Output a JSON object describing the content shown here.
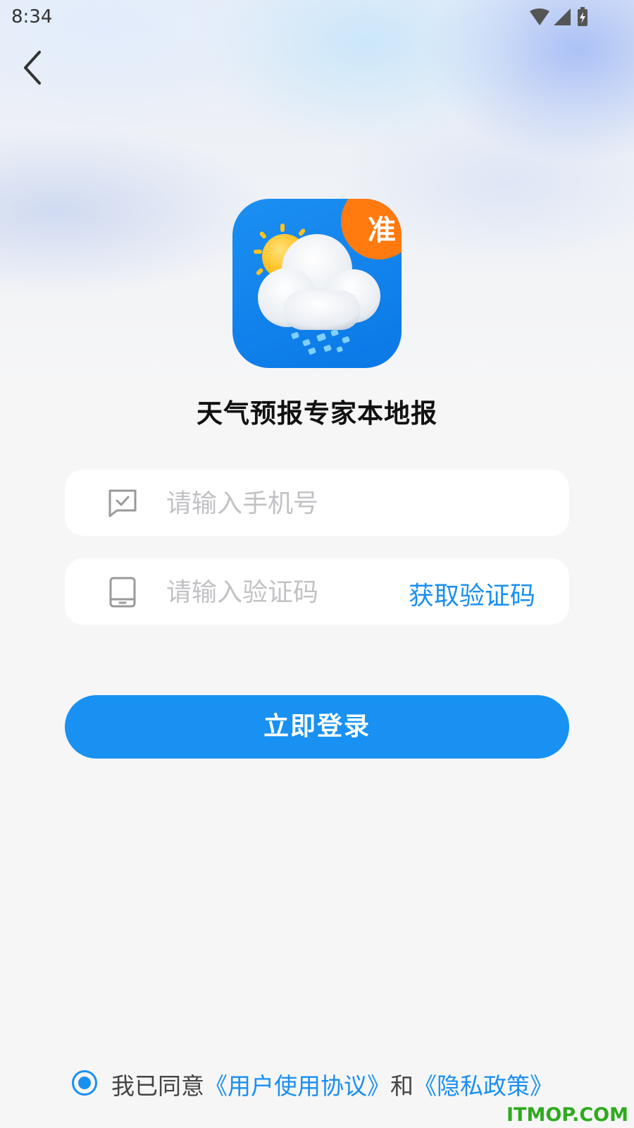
{
  "status_bar": {
    "time": "8:34"
  },
  "app": {
    "name": "天气预报专家本地报",
    "badge": "准"
  },
  "form": {
    "phone_placeholder": "请输入手机号",
    "code_placeholder": "请输入验证码",
    "get_code_label": "获取验证码"
  },
  "login_button": "立即登录",
  "agreement": {
    "prefix": "我已同意",
    "user_agreement": "《用户使用协议》",
    "conjunction": "和",
    "privacy_policy": "《隐私政策》",
    "checked": true
  },
  "watermark": "ITMOP.COM",
  "colors": {
    "accent": "#1891f2",
    "badge": "#ff7a0f",
    "watermark": "#2eaa1e"
  },
  "icons": [
    "back-arrow-icon",
    "wifi-icon",
    "signal-icon",
    "battery-icon",
    "message-check-icon",
    "phone-icon"
  ]
}
